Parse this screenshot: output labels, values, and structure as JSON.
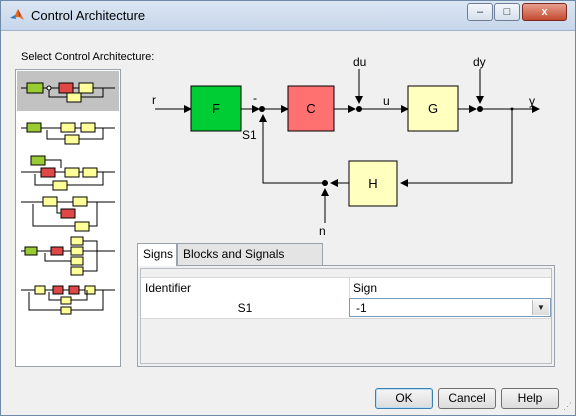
{
  "window": {
    "title": "Control Architecture"
  },
  "titlebar": {
    "minimize": "–",
    "maximize": "□",
    "close": "x"
  },
  "selector": {
    "label": "Select Control Architecture:",
    "item_count": 6,
    "selected_index": 0
  },
  "diagram": {
    "blocks": {
      "F": "F",
      "C": "C",
      "G": "G",
      "H": "H"
    },
    "signals": {
      "r": "r",
      "du": "du",
      "u": "u",
      "dy": "dy",
      "y": "y",
      "n": "n",
      "S1": "S1"
    },
    "colors": {
      "F": "#00cc33",
      "C": "#ff7070",
      "G": "#ffffc0",
      "H": "#ffffc0"
    }
  },
  "tabs": [
    {
      "label": "Signs",
      "active": true
    },
    {
      "label": "Blocks and Signals",
      "active": false
    }
  ],
  "signs_table": {
    "headers": [
      "Identifier",
      "Sign"
    ],
    "rows": [
      {
        "identifier": "S1",
        "sign": "-1"
      }
    ]
  },
  "buttons": {
    "ok": "OK",
    "cancel": "Cancel",
    "help": "Help"
  },
  "icons": {
    "app": "matlab-logo-icon",
    "dropdown": "dropdown-arrow-icon"
  }
}
